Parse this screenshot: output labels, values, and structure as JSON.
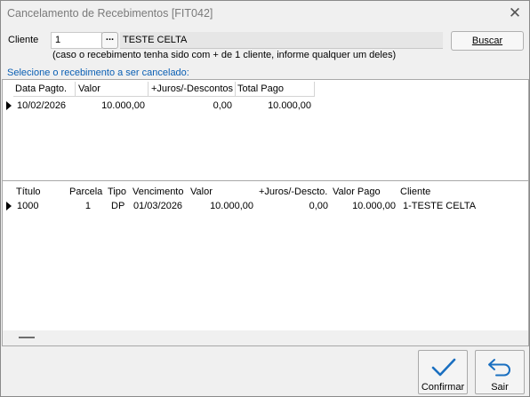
{
  "window": {
    "title": "Cancelamento de Recebimentos [FIT042]"
  },
  "cliente": {
    "label": "Cliente",
    "code": "1",
    "lookup": "...",
    "name": "TESTE CELTA",
    "hint": "(caso o recebimento tenha sido com + de 1 cliente, informe qualquer um deles)",
    "search_button": "Buscar"
  },
  "section_label": "Selecione o recebimento a ser cancelado:",
  "receipts": {
    "headers": [
      "Data Pagto.",
      "Valor",
      "+Juros/-Descontos",
      "Total Pago"
    ],
    "rows": [
      {
        "data": "10/02/2026",
        "valor": "10.000,00",
        "juros": "0,00",
        "total": "10.000,00"
      }
    ]
  },
  "titles": {
    "headers": [
      "Título",
      "Parcela",
      "Tipo",
      "Vencimento",
      "Valor",
      "+Juros/-Descto.",
      "Valor Pago",
      "Cliente"
    ],
    "rows": [
      {
        "titulo": "1000",
        "parcela": "1",
        "tipo": "DP",
        "vencimento": "01/03/2026",
        "valor": "10.000,00",
        "juros": "0,00",
        "pago": "10.000,00",
        "cliente": "1-TESTE CELTA"
      }
    ]
  },
  "actions": {
    "confirm": "Confirmar",
    "exit": "Sair"
  },
  "colors": {
    "accent": "#0a5fb4",
    "check": "#1a6fc0"
  },
  "icons": {
    "close": "close-icon",
    "confirm": "check-icon",
    "exit": "undo-arrow-icon"
  }
}
